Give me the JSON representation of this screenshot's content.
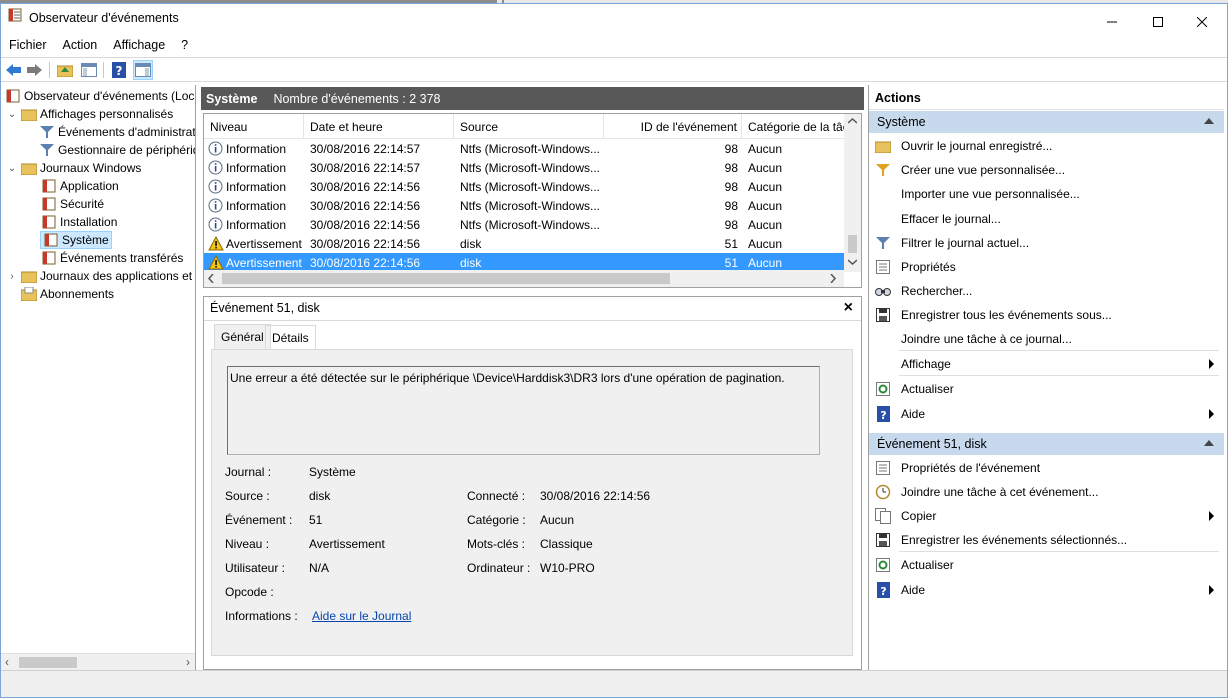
{
  "window": {
    "title": "Observateur d'événements"
  },
  "menu": [
    "Fichier",
    "Action",
    "Affichage",
    "?"
  ],
  "tree": {
    "items": [
      {
        "label": "Observateur d'événements (Local)"
      },
      {
        "label": "Affichages personnalisés"
      },
      {
        "label": "Événements d'administration"
      },
      {
        "label": "Gestionnaire de périphériques"
      },
      {
        "label": "Journaux Windows"
      },
      {
        "label": "Application"
      },
      {
        "label": "Sécurité"
      },
      {
        "label": "Installation"
      },
      {
        "label": "Système"
      },
      {
        "label": "Événements transférés"
      },
      {
        "label": "Journaux des applications et de services"
      },
      {
        "label": "Abonnements"
      }
    ]
  },
  "center": {
    "header_name": "Système",
    "header_count": "Nombre d'événements : 2 378",
    "columns": [
      "Niveau",
      "Date et heure",
      "Source",
      "ID de l'événement",
      "Catégorie de la tâche"
    ],
    "rows": [
      {
        "level": "Information",
        "date": "30/08/2016 22:14:57",
        "source": "Ntfs (Microsoft-Windows...",
        "id": "98",
        "category": "Aucun"
      },
      {
        "level": "Information",
        "date": "30/08/2016 22:14:57",
        "source": "Ntfs (Microsoft-Windows...",
        "id": "98",
        "category": "Aucun"
      },
      {
        "level": "Information",
        "date": "30/08/2016 22:14:56",
        "source": "Ntfs (Microsoft-Windows...",
        "id": "98",
        "category": "Aucun"
      },
      {
        "level": "Information",
        "date": "30/08/2016 22:14:56",
        "source": "Ntfs (Microsoft-Windows...",
        "id": "98",
        "category": "Aucun"
      },
      {
        "level": "Information",
        "date": "30/08/2016 22:14:56",
        "source": "Ntfs (Microsoft-Windows...",
        "id": "98",
        "category": "Aucun"
      },
      {
        "level": "Avertissement",
        "date": "30/08/2016 22:14:56",
        "source": "disk",
        "id": "51",
        "category": "Aucun"
      },
      {
        "level": "Avertissement",
        "date": "30/08/2016 22:14:56",
        "source": "disk",
        "id": "51",
        "category": "Aucun"
      }
    ]
  },
  "detail": {
    "title": "Événement 51, disk",
    "tabs": [
      "Général",
      "Détails"
    ],
    "message": "Une erreur a été détectée sur le périphérique \\Device\\Harddisk3\\DR3 lors d'une opération de pagination.",
    "fields": {
      "journal_label": "Journal :",
      "journal_value": "Système",
      "source_label": "Source :",
      "source_value": "disk",
      "event_label": "Événement :",
      "event_value": "51",
      "level_label": "Niveau :",
      "level_value": "Avertissement",
      "user_label": "Utilisateur :",
      "user_value": "N/A",
      "opcode_label": "Opcode :",
      "opcode_value": "",
      "info_label": "Informations :",
      "info_link": "Aide sur le Journal",
      "connected_label": "Connecté :",
      "connected_value": "30/08/2016 22:14:56",
      "category_label": "Catégorie :",
      "category_value": "Aucun",
      "keywords_label": "Mots-clés :",
      "keywords_value": "Classique",
      "computer_label": "Ordinateur :",
      "computer_value": "W10-PRO"
    }
  },
  "actions": {
    "title": "Actions",
    "section1": "Système",
    "section1_items": [
      "Ouvrir le journal enregistré...",
      "Créer une vue personnalisée...",
      "Importer une vue personnalisée...",
      "Effacer le journal...",
      "Filtrer le journal actuel...",
      "Propriétés",
      "Rechercher...",
      "Enregistrer tous les événements sous...",
      "Joindre une tâche à ce journal...",
      "Affichage",
      "Actualiser",
      "Aide"
    ],
    "section2": "Événement 51, disk",
    "section2_items": [
      "Propriétés de l'événement",
      "Joindre une tâche à cet événement...",
      "Copier",
      "Enregistrer les événements sélectionnés...",
      "Actualiser",
      "Aide"
    ]
  },
  "colors": {
    "selection": "#3399ff",
    "section_header": "#c7d9ed",
    "pane_header": "#585858"
  }
}
